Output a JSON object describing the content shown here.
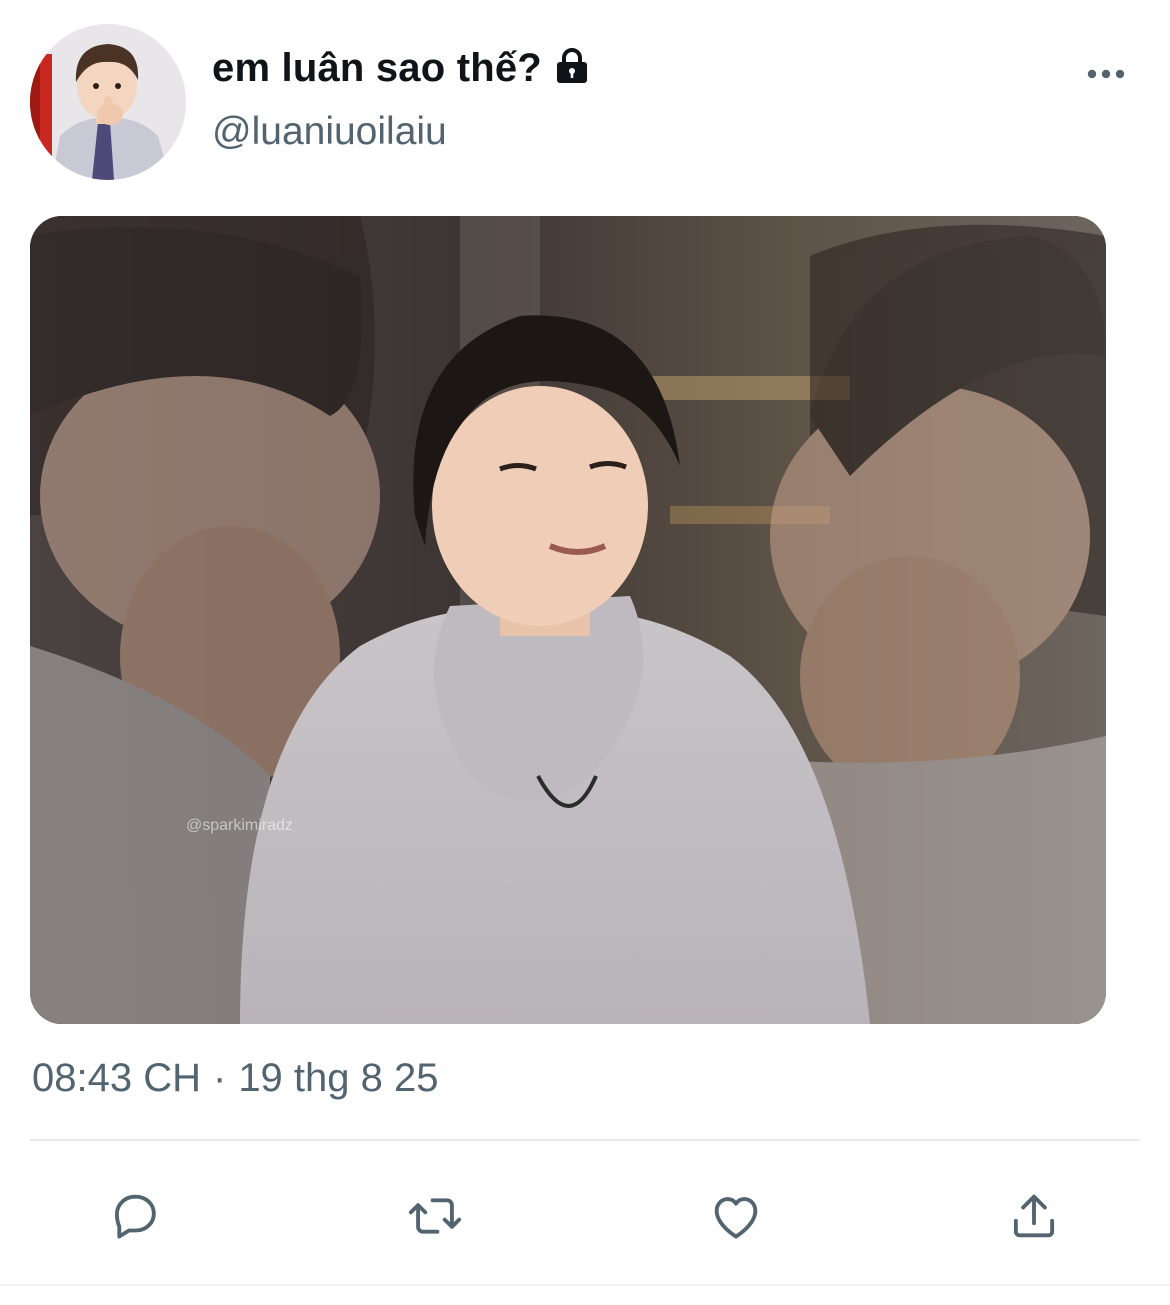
{
  "tweet": {
    "display_name": "em luân sao thế?",
    "handle": "@luaniuoilaiu",
    "time": "08:43 CH",
    "separator": "·",
    "date": "19 thg 8 25",
    "media_watermark": "@sparkimiradz"
  },
  "icons": {
    "protected": "lock-icon",
    "more": "more-dots-icon",
    "reply": "reply-icon",
    "retweet": "retweet-icon",
    "like": "heart-icon",
    "share": "share-icon"
  },
  "colors": {
    "text_primary": "#0f1419",
    "text_secondary": "#536471",
    "divider": "#e6e9ec"
  }
}
